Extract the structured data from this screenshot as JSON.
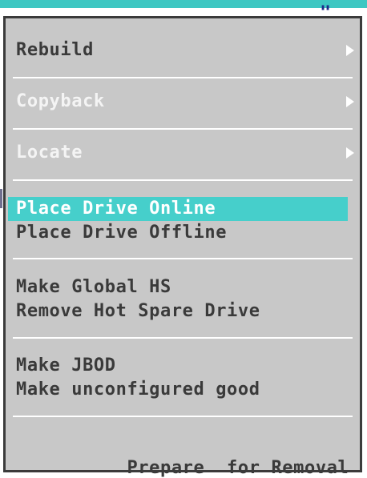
{
  "menu": {
    "items": [
      {
        "label": "Rebuild",
        "state": "enabled",
        "submenu": true
      },
      {
        "label": "Copyback",
        "state": "disabled",
        "submenu": true
      },
      {
        "label": "Locate",
        "state": "disabled",
        "submenu": true
      },
      {
        "label": "Place Drive Online",
        "state": "highlighted",
        "submenu": false
      },
      {
        "label": "Place Drive Offline",
        "state": "enabled",
        "submenu": false
      },
      {
        "label": "Make Global HS",
        "state": "enabled",
        "submenu": false
      },
      {
        "label": "Remove Hot Spare Drive",
        "state": "enabled",
        "submenu": false
      },
      {
        "label": "Make JBOD",
        "state": "enabled",
        "submenu": false
      },
      {
        "label": "Make unconfigured good",
        "state": "enabled",
        "submenu": false
      },
      {
        "label": "Prepare  for Removal",
        "state": "enabled",
        "submenu": false
      }
    ]
  },
  "colors": {
    "menu_background": "#c8c8c8",
    "highlight": "#46cfcb",
    "enabled_text": "#3a3a3a",
    "disabled_text": "#f4f4f4",
    "border": "#3b3b3b"
  },
  "icons": {
    "submenu_arrow": "triangle-right"
  }
}
